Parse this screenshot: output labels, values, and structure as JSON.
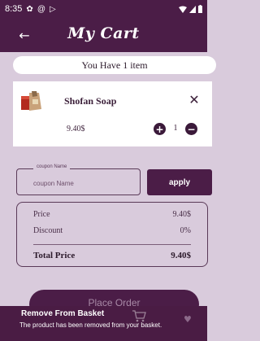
{
  "status_bar": {
    "time": "8:35",
    "icons": [
      "settings-icon",
      "at-icon",
      "play-store-icon"
    ],
    "right_icons": [
      "wifi-icon",
      "signal-icon",
      "battery-icon"
    ]
  },
  "app_bar": {
    "title": "My Cart",
    "back_icon": "arrow-left-icon"
  },
  "cart_summary": {
    "count_text": "You Have 1 item"
  },
  "items": [
    {
      "name": "Shofan Soap",
      "price": "9.40$",
      "quantity": "1",
      "image_icon": "soap-product-image",
      "remove_icon": "close-icon"
    }
  ],
  "coupon": {
    "label": "coupon Name",
    "placeholder": "coupon Name",
    "apply_label": "apply"
  },
  "summary": {
    "price_label": "Price",
    "price_value": "9.40$",
    "discount_label": "Discount",
    "discount_value": "0%",
    "total_label": "Total Price",
    "total_value": "9.40$"
  },
  "place_order_label": "Place Order",
  "toast": {
    "title": "Remove From Basket",
    "message": "The product has been removed from your basket."
  },
  "colors": {
    "primary": "#4b1d47",
    "background": "#d9cbdc",
    "card": "#ffffff"
  }
}
